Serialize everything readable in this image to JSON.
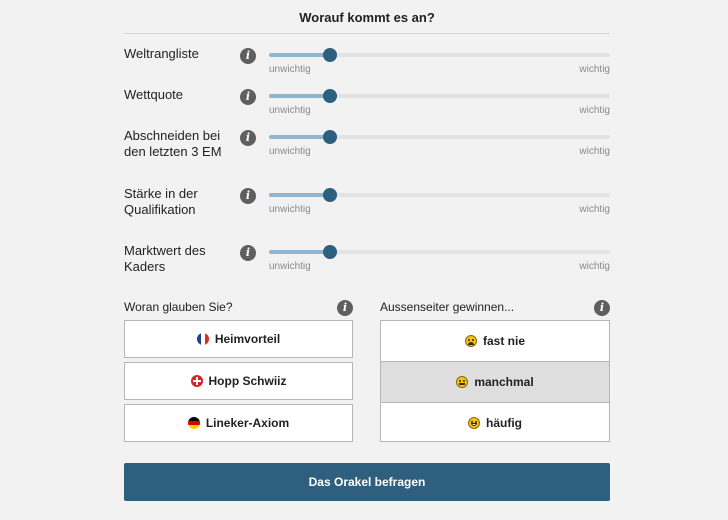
{
  "header": {
    "title": "Worauf kommt es an?"
  },
  "sliders": [
    {
      "label": "Weltrangliste",
      "min_label": "unwichtig",
      "max_label": "wichtig",
      "value": 0.18
    },
    {
      "label": "Wettquote",
      "min_label": "unwichtig",
      "max_label": "wichtig",
      "value": 0.18
    },
    {
      "label": "Abschneiden bei den letzten 3 EM",
      "min_label": "unwichtig",
      "max_label": "wichtig",
      "value": 0.18
    },
    {
      "label": "Stärke in der Qualifikation",
      "min_label": "unwichtig",
      "max_label": "wichtig",
      "value": 0.18
    },
    {
      "label": "Marktwert des Kaders",
      "min_label": "unwichtig",
      "max_label": "wichtig",
      "value": 0.18
    }
  ],
  "beliefs": {
    "label": "Woran glauben Sie?",
    "options": [
      {
        "label": "Heimvorteil",
        "icon": "france-flag-icon"
      },
      {
        "label": "Hopp Schwiiz",
        "icon": "swiss-flag-icon"
      },
      {
        "label": "Lineker-Axiom",
        "icon": "germany-flag-icon"
      }
    ]
  },
  "underdogs": {
    "label": "Aussenseiter gewinnen...",
    "selected": "manchmal",
    "options": [
      {
        "label": "fast nie",
        "icon": "sad-face-icon"
      },
      {
        "label": "manchmal",
        "icon": "neutral-face-icon"
      },
      {
        "label": "häufig",
        "icon": "happy-face-icon"
      }
    ]
  },
  "cta": {
    "label": "Das Orakel befragen"
  },
  "colors": {
    "accent": "#2e5f7e",
    "track_fill": "#8fb5cf",
    "background": "#f2f2f2"
  }
}
